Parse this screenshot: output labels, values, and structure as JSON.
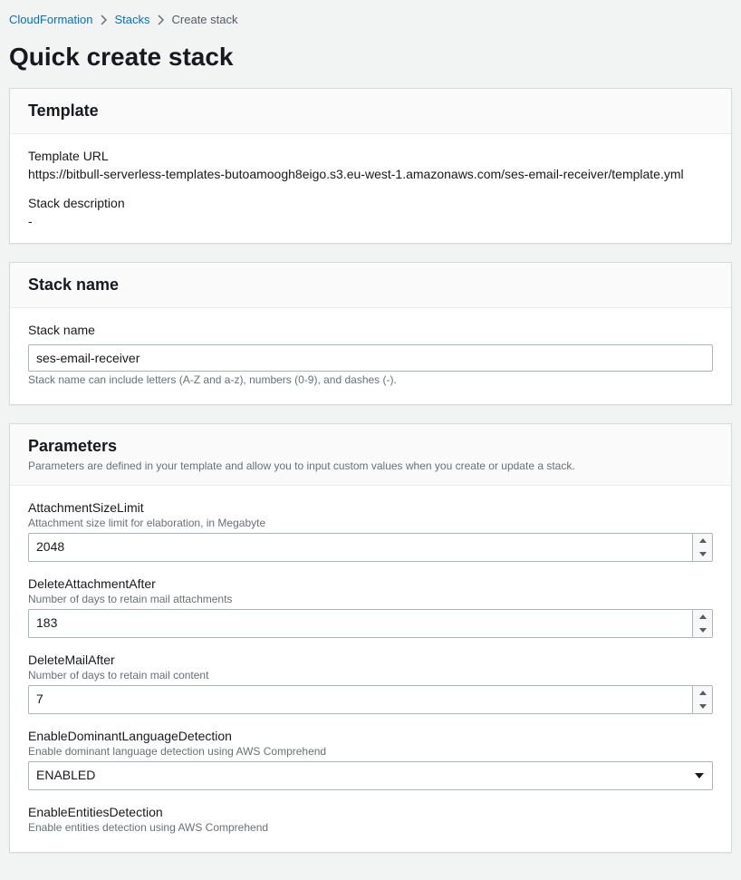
{
  "breadcrumb": {
    "root": "CloudFormation",
    "stacks": "Stacks",
    "current": "Create stack"
  },
  "page_title": "Quick create stack",
  "template_panel": {
    "heading": "Template",
    "url_label": "Template URL",
    "url_value": "https://bitbull-serverless-templates-butoamoogh8eigo.s3.eu-west-1.amazonaws.com/ses-email-receiver/template.yml",
    "desc_label": "Stack description",
    "desc_value": "-"
  },
  "stackname_panel": {
    "heading": "Stack name",
    "field_label": "Stack name",
    "value": "ses-email-receiver",
    "help": "Stack name can include letters (A-Z and a-z), numbers (0-9), and dashes (-)."
  },
  "parameters_panel": {
    "heading": "Parameters",
    "subtitle": "Parameters are defined in your template and allow you to input custom values when you create or update a stack.",
    "items": [
      {
        "name": "AttachmentSizeLimit",
        "help": "Attachment size limit for elaboration, in Megabyte",
        "value": "2048",
        "type": "number"
      },
      {
        "name": "DeleteAttachmentAfter",
        "help": "Number of days to retain mail attachments",
        "value": "183",
        "type": "number"
      },
      {
        "name": "DeleteMailAfter",
        "help": "Number of days to retain mail content",
        "value": "7",
        "type": "number"
      },
      {
        "name": "EnableDominantLanguageDetection",
        "help": "Enable dominant language detection using AWS Comprehend",
        "value": "ENABLED",
        "type": "select"
      },
      {
        "name": "EnableEntitiesDetection",
        "help": "Enable entities detection using AWS Comprehend",
        "value": "",
        "type": "select"
      }
    ]
  }
}
